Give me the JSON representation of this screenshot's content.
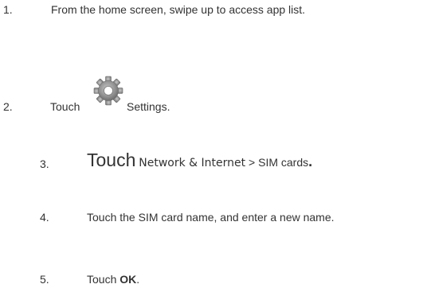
{
  "steps": [
    {
      "number": "1.",
      "text": "From the home screen, swipe up to access app list."
    },
    {
      "number": "2.",
      "before": "Touch",
      "icon": "settings-gear-icon",
      "after": "Settings."
    },
    {
      "number": "3.",
      "touch": "Touch",
      "path": "Network & Internet",
      "separator": " > ",
      "sim": "SIM cards",
      "end": "."
    },
    {
      "number": "4.",
      "text": "Touch the SIM card name, and enter a new name."
    },
    {
      "number": "5.",
      "before": "Touch ",
      "bold": "OK",
      "end": "."
    }
  ]
}
